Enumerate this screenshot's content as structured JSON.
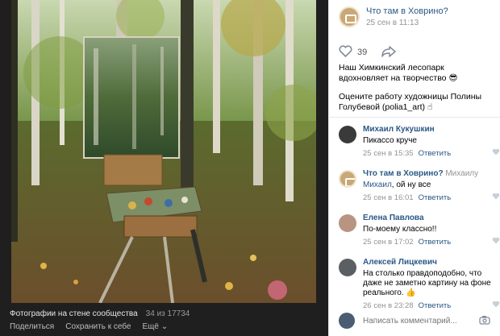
{
  "viewer": {
    "album_label": "Фотографии на стене сообщества",
    "photo_count": "34 из 17734",
    "actions": {
      "share": "Поделиться",
      "save": "Сохранить к себе",
      "more": "Ещё"
    }
  },
  "post": {
    "author": "Что там в Ховрино?",
    "date": "25 сен в 11:13",
    "likes": "39",
    "text_line1": "Наш Химкинский лесопарк вдохновляет на творчество",
    "text_line2": "Оцените работу художницы Полины Голубевой (polia1_art)"
  },
  "comments": [
    {
      "name": "Михаил Кукушкин",
      "reply_to": "",
      "mention": "",
      "text": "Пикассо круче",
      "date": "25 сен в 15:35",
      "reply": "Ответить",
      "avatar_color": "#3a3a3a"
    },
    {
      "name": "Что там в Ховрино?",
      "reply_to": "Михаилу",
      "mention": "Михаил",
      "text": ", ой ну все",
      "date": "25 сен в 16:01",
      "reply": "Ответить",
      "avatar_color": "#c9a877"
    },
    {
      "name": "Елена Павлова",
      "reply_to": "",
      "mention": "",
      "text": "По-моему классно!!",
      "date": "25 сен в 17:02",
      "reply": "Ответить",
      "avatar_color": "#b99480"
    },
    {
      "name": "Алексей Лицкевич",
      "reply_to": "",
      "mention": "",
      "text": "На столько правдоподобно, что даже не заметно картину на фоне реального.",
      "date": "26 сен в 23:28",
      "reply": "Ответить",
      "avatar_color": "#5b5f63"
    }
  ],
  "comment_input": {
    "placeholder": "Написать комментарий..."
  },
  "icons": [
    "heart-icon",
    "share-arrow-icon",
    "camera-icon",
    "attach-camera-icon"
  ],
  "colors": {
    "link": "#2a5885",
    "muted": "#939393",
    "viewer_bg": "#1f1f1f"
  }
}
